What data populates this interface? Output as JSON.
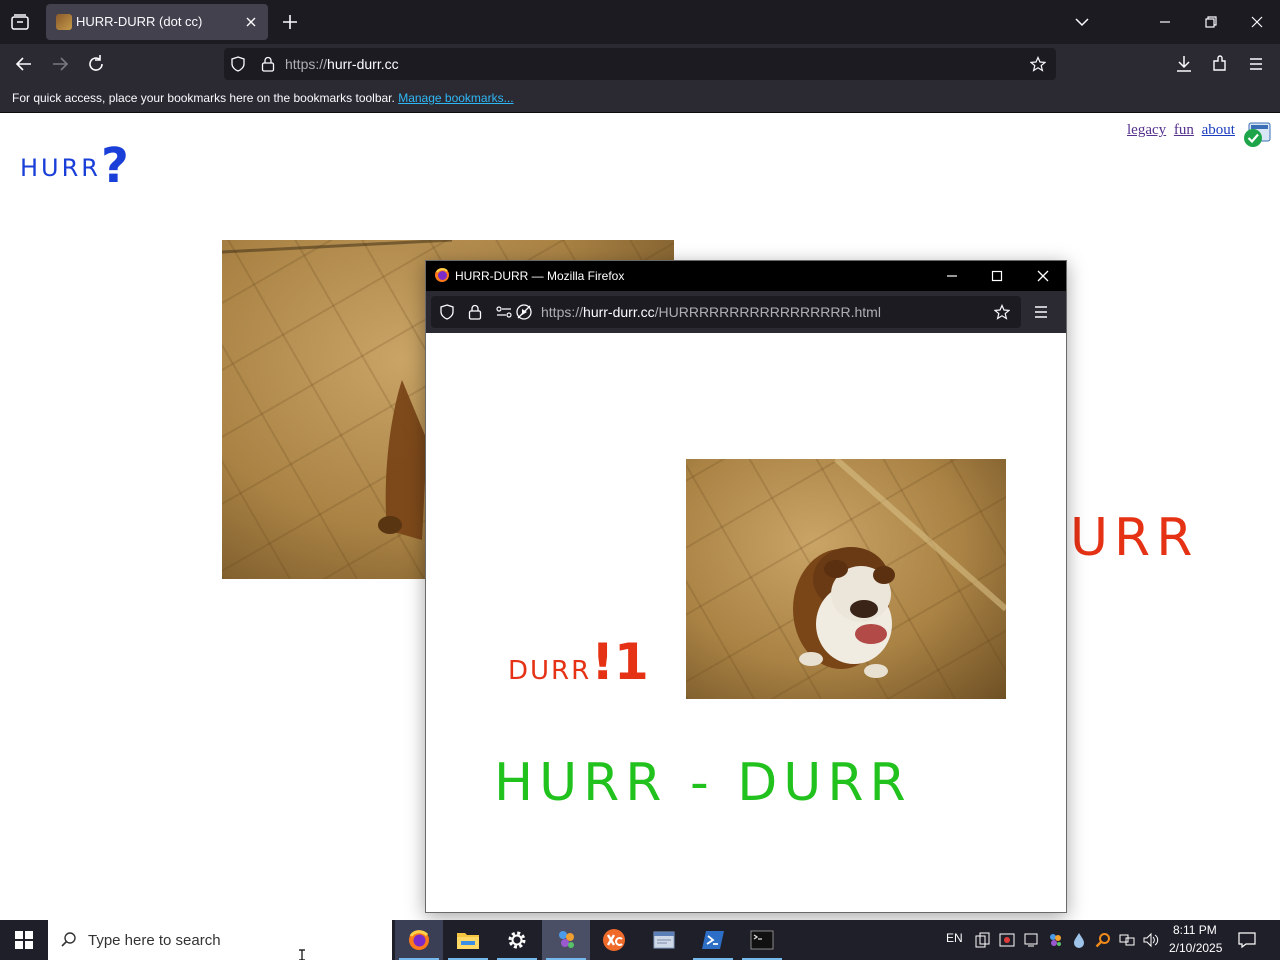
{
  "browser": {
    "tab_title": "HURR-DURR (dot cc)",
    "url_scheme": "https://",
    "url_host": "hurr-durr.cc",
    "bookmarks_text": "For quick access, place your bookmarks here on the bookmarks toolbar.",
    "bookmarks_link": "Manage bookmarks..."
  },
  "page": {
    "logo_word": "HURR",
    "logo_mark": "?",
    "links": [
      "legacy",
      "fun",
      "about"
    ],
    "urr_text": "URR"
  },
  "popup": {
    "title": "HURR-DURR — Mozilla Firefox",
    "url_scheme": "https://",
    "url_host": "hurr-durr.cc",
    "url_path": "/HURRRRRRRRRRRRRRRRR.html",
    "durr_small": "DURR",
    "durr_big": "!1",
    "headline": "HURR - DURR"
  },
  "taskbar": {
    "search_placeholder": "Type here to search",
    "language": "EN",
    "time": "8:11 PM",
    "date": "2/10/2025"
  },
  "colors": {
    "logo_blue": "#1a3fd8",
    "durr_red": "#e53215",
    "headline_green": "#22c21e",
    "link_blue": "#2fb7f5"
  }
}
